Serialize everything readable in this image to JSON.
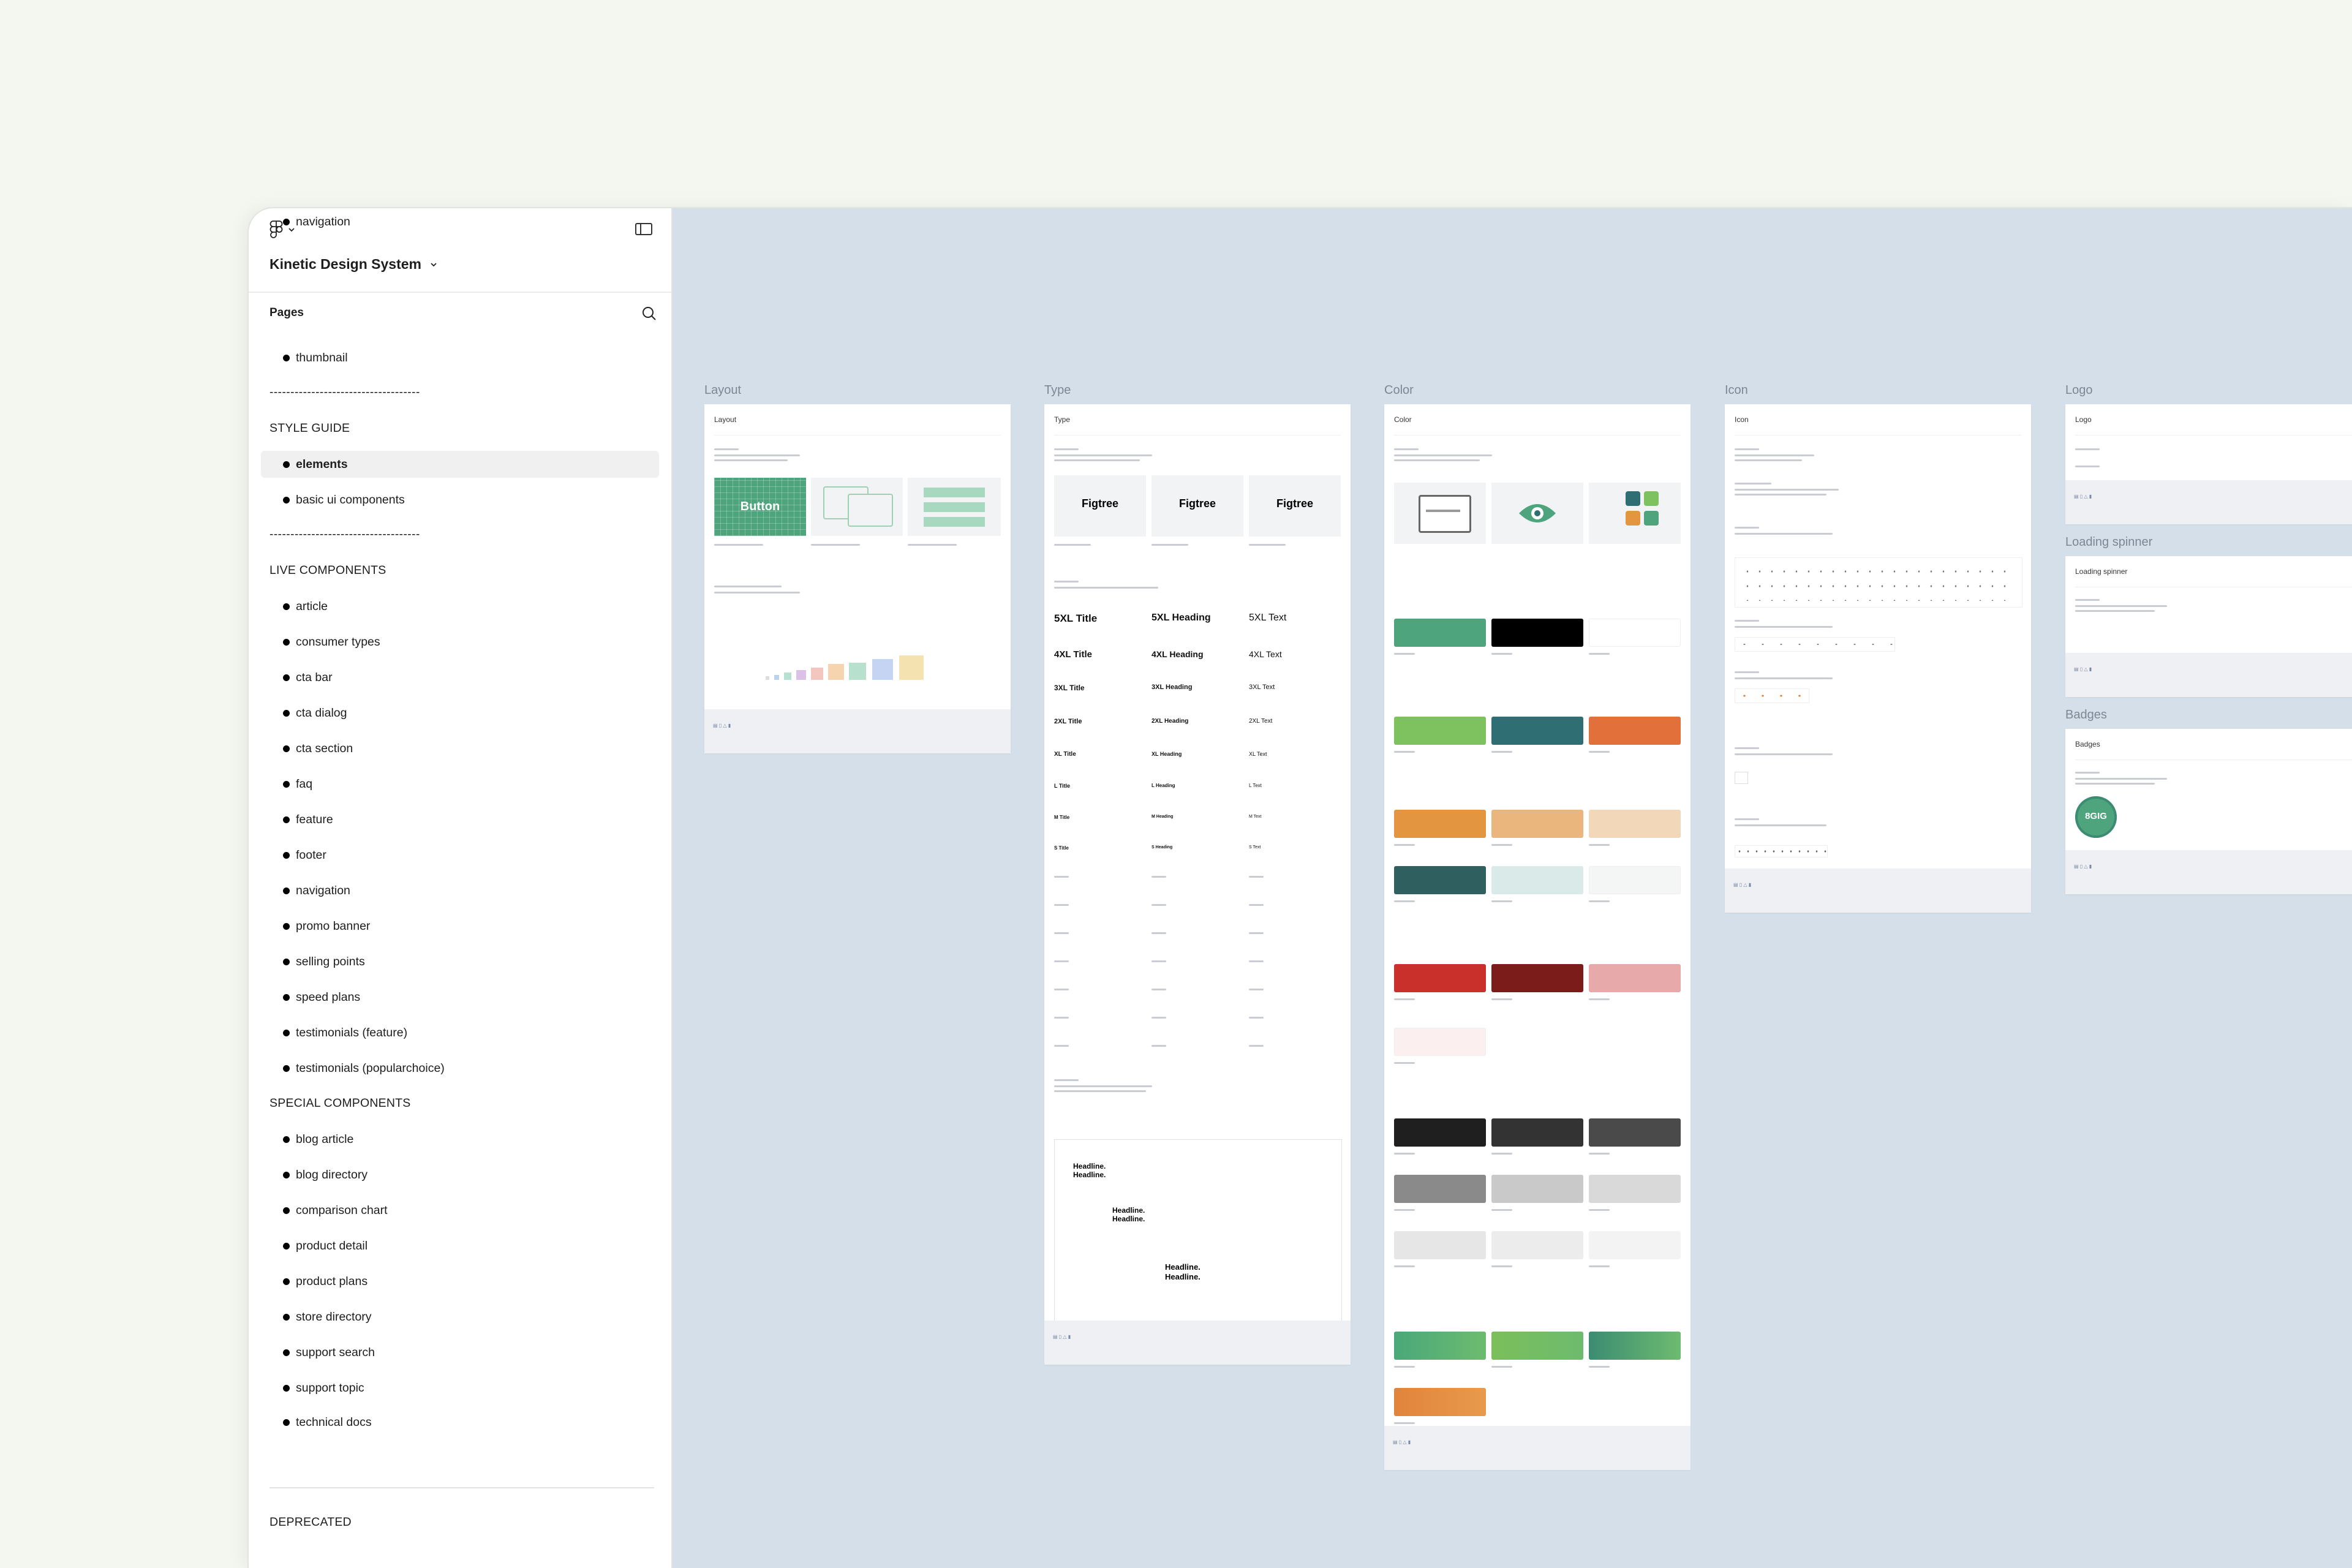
{
  "sidebar": {
    "file_title": "Kinetic Design System",
    "pages_heading": "Pages",
    "items": [
      {
        "kind": "page",
        "label": "thumbnail"
      },
      {
        "kind": "divider",
        "label": "------------------------------------"
      },
      {
        "kind": "section",
        "label": "STYLE GUIDE"
      },
      {
        "kind": "page",
        "label": "elements",
        "selected": true
      },
      {
        "kind": "page",
        "label": "basic ui components"
      },
      {
        "kind": "divider",
        "label": "------------------------------------"
      },
      {
        "kind": "section",
        "label": "LIVE COMPONENTS"
      },
      {
        "kind": "page",
        "label": "article"
      },
      {
        "kind": "page",
        "label": "consumer types"
      },
      {
        "kind": "page",
        "label": "cta bar"
      },
      {
        "kind": "page",
        "label": "cta dialog"
      },
      {
        "kind": "page",
        "label": "cta section"
      },
      {
        "kind": "page",
        "label": "faq"
      },
      {
        "kind": "page",
        "label": "feature"
      },
      {
        "kind": "page",
        "label": "footer"
      },
      {
        "kind": "page",
        "label": "navigation"
      },
      {
        "kind": "page",
        "label": "promo banner"
      },
      {
        "kind": "page",
        "label": "selling points"
      },
      {
        "kind": "page",
        "label": "speed plans"
      },
      {
        "kind": "page",
        "label": "testimonials (feature)"
      },
      {
        "kind": "page",
        "label": "testimonials (popularchoice)"
      },
      {
        "kind": "section",
        "label": "SPECIAL COMPONENTS"
      },
      {
        "kind": "page",
        "label": "blog article"
      },
      {
        "kind": "page",
        "label": "blog directory"
      },
      {
        "kind": "page",
        "label": "comparison chart"
      },
      {
        "kind": "page",
        "label": "product detail"
      },
      {
        "kind": "page",
        "label": "product plans"
      },
      {
        "kind": "page",
        "label": "store directory"
      },
      {
        "kind": "page",
        "label": "support search"
      },
      {
        "kind": "page",
        "label": "support topic"
      },
      {
        "kind": "page",
        "label": "technical docs"
      },
      {
        "kind": "rule"
      },
      {
        "kind": "section",
        "label": "DEPRECATED"
      },
      {
        "kind": "page",
        "label": "navigation"
      }
    ]
  },
  "canvas": {
    "frames": {
      "layout": {
        "label": "Layout",
        "title": "Layout",
        "button_text": "Button"
      },
      "type": {
        "label": "Type",
        "title": "Type",
        "font_cards": [
          "Figtree",
          "Figtree",
          "Figtree"
        ],
        "scale_rows": [
          [
            "5XL Title",
            "5XL Heading",
            "5XL Text"
          ],
          [
            "4XL Title",
            "4XL Heading",
            "4XL Text"
          ],
          [
            "3XL Title",
            "3XL Heading",
            "3XL Text"
          ],
          [
            "2XL Title",
            "2XL Heading",
            "2XL Text"
          ],
          [
            "XL Title",
            "XL Heading",
            "XL Text"
          ],
          [
            "L Title",
            "L Heading",
            "L Text"
          ],
          [
            "M Title",
            "M Heading",
            "M Text"
          ],
          [
            "S Title",
            "S Heading",
            "S Text"
          ]
        ],
        "headline_samples": [
          "Headline.\nHeadline.",
          "Headline.\nHeadline.",
          "Headline.\nHeadline."
        ]
      },
      "color": {
        "label": "Color",
        "title": "Color",
        "swatch_rows": [
          [
            "#4ea47c",
            "#000000",
            "#ffffff"
          ],
          [
            "#7dc25e",
            "#2f6f73",
            "#e1703a"
          ],
          [
            "#e3963f",
            "#ebb57e",
            "#f2d7b8"
          ],
          [
            "#2f5f5f",
            "#d9eae8",
            "#f3f6f4"
          ],
          [
            "#c9302c",
            "#7c1c1a",
            "#e8a9aa"
          ],
          [
            "#fbf0ef"
          ],
          [
            "#1f1f1f",
            "#333333",
            "#4a4a4a"
          ],
          [
            "#8a8a8a",
            "#c9c9c9",
            "#d9d9d9"
          ],
          [
            "#e6e6e6",
            "#ececec",
            "#f3f3f3"
          ],
          [
            "#49a87a",
            "#7bbf5a",
            "#3c8c73"
          ],
          [
            "#e1843c"
          ]
        ]
      },
      "icon": {
        "label": "Icon",
        "title": "Icon"
      },
      "logo": {
        "label": "Logo",
        "title": "Logo"
      },
      "spinner": {
        "label": "Loading spinner",
        "title": "Loading spinner"
      },
      "badges": {
        "label": "Badges",
        "title": "Badges",
        "badge_text": "8GIG"
      }
    },
    "accent_colors": {
      "canvas_bg": "#d5dfe9",
      "page_bg": "#f3f7ef",
      "brand_green": "#4ea47c"
    }
  }
}
